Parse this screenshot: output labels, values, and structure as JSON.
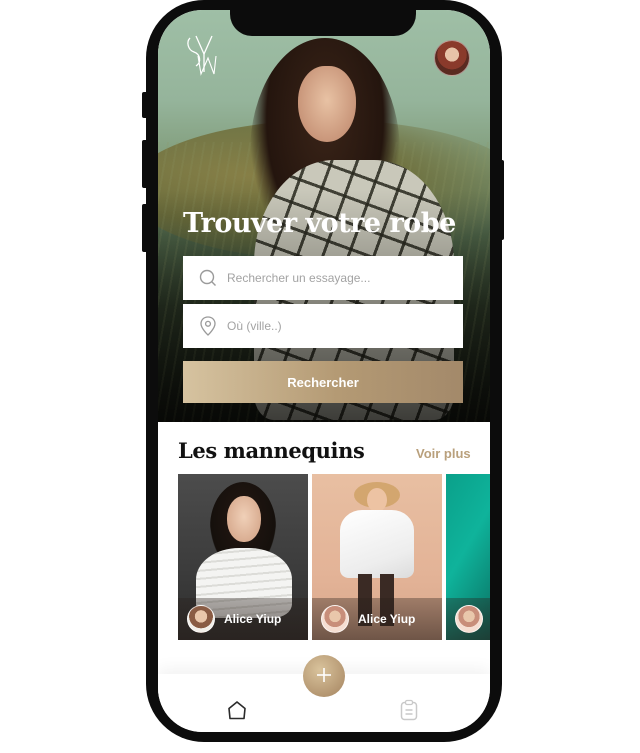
{
  "hero": {
    "title": "Trouver votre robe",
    "search_placeholder": "Rechercher un essayage...",
    "location_placeholder": "Où (ville..)",
    "search_button": "Rechercher"
  },
  "models": {
    "title": "Les mannequins",
    "see_more": "Voir plus",
    "cards": [
      {
        "name": "Alice Yiup"
      },
      {
        "name": "Alice Yiup"
      }
    ]
  },
  "icons": {
    "logo": "logo-monogram-icon",
    "profile": "profile-avatar",
    "search": "search-icon",
    "location": "location-pin-icon",
    "add": "plus-icon",
    "home": "home-icon",
    "list": "clipboard-icon"
  },
  "colors": {
    "accent_gold": "#b9a07c",
    "button_gradient_start": "#d6c3a0",
    "button_gradient_end": "#a3896a",
    "hero_green": "#95b49b",
    "card_teal": "#0fb39b"
  }
}
